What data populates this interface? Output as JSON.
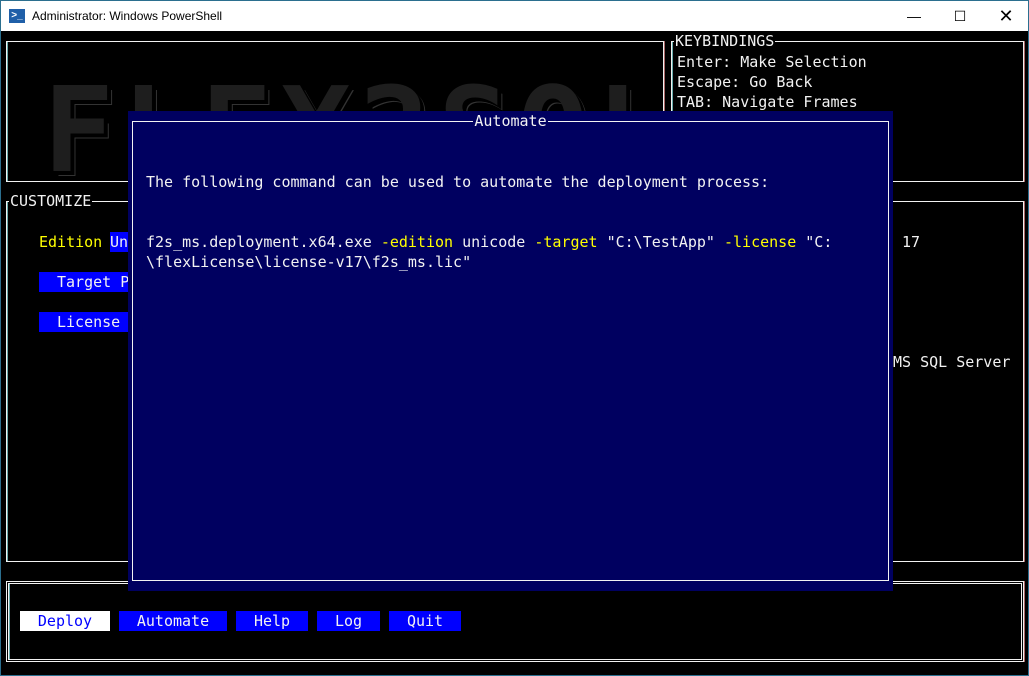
{
  "window": {
    "title": "Administrator: Windows PowerShell",
    "icon": "powershell-icon",
    "controls": [
      "minimize",
      "maximize",
      "close"
    ]
  },
  "logo": {
    "text": "FLEX2SQL"
  },
  "keybindings": {
    "title": "KEYBINDINGS",
    "items": [
      "Enter: Make Selection",
      "Escape: Go Back",
      "TAB: Navigate Frames"
    ]
  },
  "customize": {
    "title": "CUSTOMIZE",
    "edition_label": "Edition",
    "edition_value": "Un",
    "target_button": "Target P",
    "license_button": "License",
    "version": "17",
    "server": "MS SQL Server"
  },
  "actions": {
    "buttons": [
      "Deploy",
      "Automate",
      "Help",
      "Log",
      "Quit"
    ],
    "selected": "Deploy"
  },
  "dialog": {
    "title": "Automate",
    "message": "The following command can be used to automate the deployment process:",
    "command": {
      "exe": "f2s_ms.deployment.x64.exe",
      "edition_flag": "-edition",
      "edition_value": "unicode",
      "target_flag": "-target",
      "target_value": "\"C:\\TestApp\"",
      "license_flag": "-license",
      "license_value_1": "\"C:",
      "license_value_2": "\\flexLicense\\license-v17\\f2s_ms.lic\""
    }
  },
  "colors": {
    "button": "#0000ff",
    "dialog_bg": "#000060",
    "flag": "#ffff00"
  }
}
